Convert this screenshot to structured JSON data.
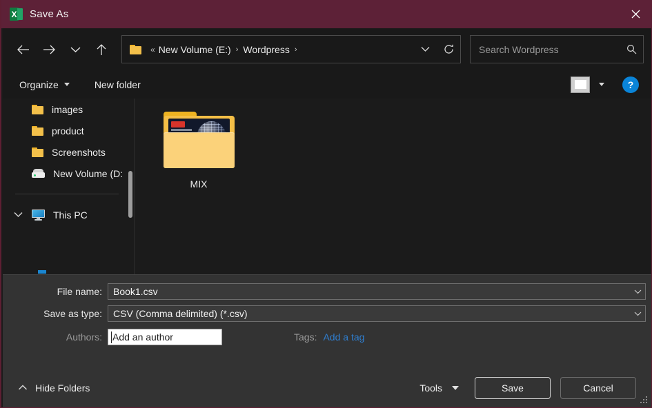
{
  "window": {
    "title": "Save As",
    "app_icon": "excel-icon",
    "close_label": "×",
    "accent_titlebar": "#5d2137"
  },
  "nav": {
    "back": "back-arrow",
    "forward": "forward-arrow",
    "recent": "recent-locations-chevron",
    "up": "up-arrow",
    "address": {
      "folder_icon": "folder-icon",
      "overflow": "«",
      "crumbs": [
        {
          "label": "New Volume (E:)",
          "sep": "›"
        },
        {
          "label": "Wordpress",
          "sep": "›"
        }
      ],
      "dropdown_icon": "chevron-down-icon",
      "refresh_icon": "refresh-icon"
    },
    "search": {
      "placeholder": "Search Wordpress",
      "icon": "search-icon"
    }
  },
  "toolbar": {
    "organize_label": "Organize",
    "new_folder_label": "New folder",
    "view_icon": "view-layout-icon",
    "view_caret": "chevron-down-icon",
    "help_label": "?"
  },
  "sidebar": {
    "items": [
      {
        "label": "images",
        "icon": "folder-icon",
        "type": "folder"
      },
      {
        "label": "product",
        "icon": "folder-icon",
        "type": "folder"
      },
      {
        "label": "Screenshots",
        "icon": "folder-icon",
        "type": "folder"
      },
      {
        "label": "New Volume (D:",
        "icon": "drive-icon",
        "type": "drive"
      }
    ],
    "root": {
      "label": "This PC",
      "icon": "this-pc-icon",
      "chevron": "chevron-down-icon"
    }
  },
  "files": [
    {
      "name": "MIX",
      "type": "folder",
      "icon": "folder-thumbnail-icon"
    }
  ],
  "form": {
    "file_name_label": "File name:",
    "file_name_value": "Book1.csv",
    "save_as_type_label": "Save as type:",
    "save_as_type_value": "CSV (Comma delimited) (*.csv)",
    "authors_label": "Authors:",
    "authors_value": "Add an author",
    "tags_label": "Tags:",
    "tags_link": "Add a tag",
    "dropdown_icon": "chevron-down-icon"
  },
  "footer": {
    "hide_folders_label": "Hide Folders",
    "hide_folders_icon": "chevron-up-icon",
    "tools_label": "Tools",
    "tools_caret": "caret-down-icon",
    "save_label": "Save",
    "cancel_label": "Cancel",
    "resize_grip": "resize-grip-icon"
  }
}
